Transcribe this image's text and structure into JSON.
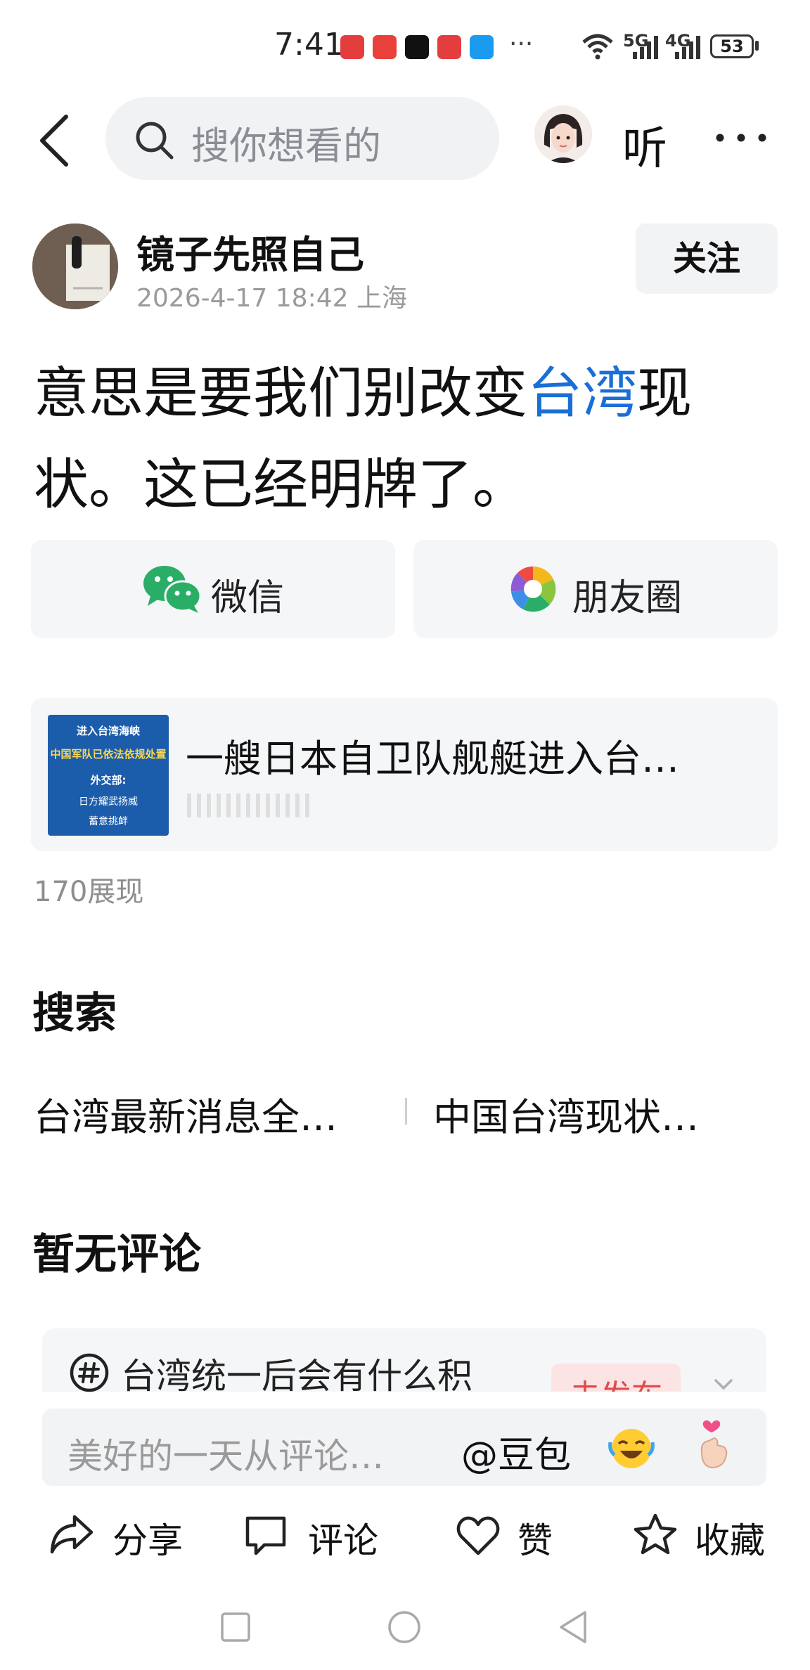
{
  "status_bar": {
    "time": "7:41",
    "more": "···",
    "signal_5g": "5G",
    "signal_4g": "4G",
    "battery": "53"
  },
  "header": {
    "search_placeholder": "搜你想看的",
    "listen_label": "听"
  },
  "post": {
    "author_name": "镜子先照自己",
    "meta": "2026-4-17 18:42 上海",
    "follow_label": "关注",
    "text_before": "意思是要我们别改变",
    "text_highlight": "台湾",
    "text_after": "现状。这已经明牌了。"
  },
  "share": {
    "wechat_label": "微信",
    "moments_label": "朋友圈"
  },
  "linked_article": {
    "title": "一艘日本自卫队舰艇进入台…",
    "thumb_lines": [
      "进入台湾海峡",
      "中国军队已依法依规处置",
      "外交部:",
      "日方耀武扬威",
      "蓄意挑衅"
    ]
  },
  "views": "170展现",
  "search_section": {
    "title": "搜索",
    "suggestions": [
      "台湾最新消息全…",
      "中国台湾现状…"
    ]
  },
  "comments_section": {
    "title": "暂无评论",
    "trending_topic": "台湾统一后会有什么积",
    "trending_button": "去发布"
  },
  "comment_input": {
    "placeholder": "美好的一天从评论…",
    "mention": "@豆包"
  },
  "actions": {
    "share": "分享",
    "comment": "评论",
    "like": "赞",
    "favorite": "收藏"
  },
  "colors": {
    "highlight": "#1a6fd6",
    "wechat_green": "#2aae67"
  }
}
